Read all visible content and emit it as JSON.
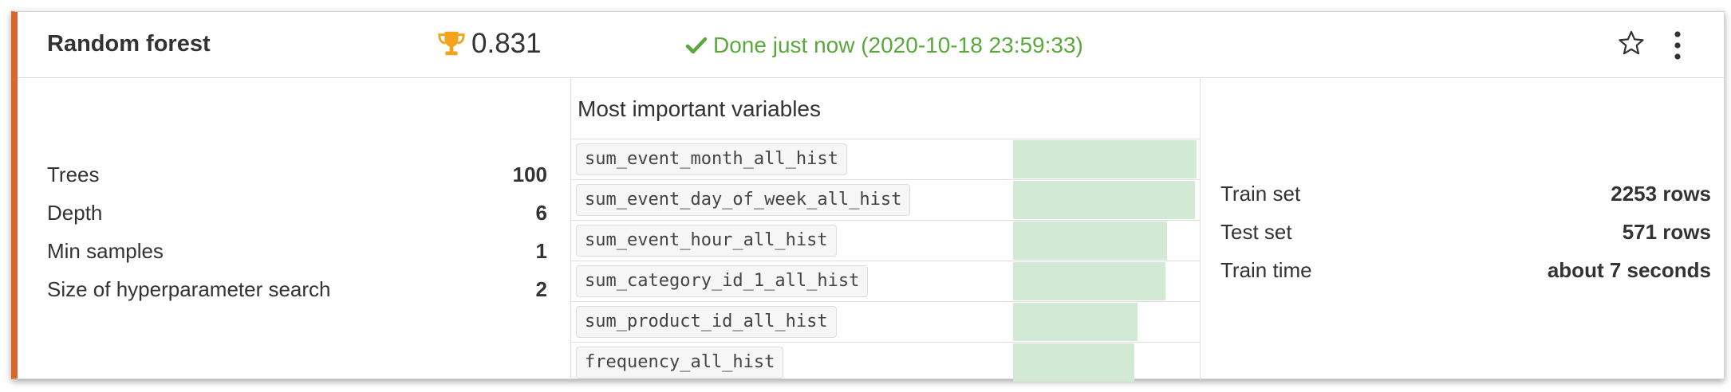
{
  "model": {
    "title": "Random forest",
    "score": "0.831",
    "status": "Done just now (2020-10-18 23:59:33)"
  },
  "colors": {
    "accent": "#d9662b",
    "success": "#5aa83c",
    "bar": "#d2e9d3",
    "trophy": "#f2a31b"
  },
  "icons": {
    "score": "trophy-icon",
    "status": "check-icon",
    "star": "star-icon",
    "menu": "more-vertical-icon"
  },
  "params": [
    {
      "label": "Trees",
      "value": "100"
    },
    {
      "label": "Depth",
      "value": "6"
    },
    {
      "label": "Min samples",
      "value": "1"
    },
    {
      "label": "Size of hyperparameter search",
      "value": "2"
    }
  ],
  "variables": {
    "title": "Most important variables",
    "items": [
      {
        "name": "sum_event_month_all_hist",
        "importance": 1.0
      },
      {
        "name": "sum_event_day_of_week_all_hist",
        "importance": 0.99
      },
      {
        "name": "sum_event_hour_all_hist",
        "importance": 0.84
      },
      {
        "name": "sum_category_id_1_all_hist",
        "importance": 0.83
      },
      {
        "name": "sum_product_id_all_hist",
        "importance": 0.68
      },
      {
        "name": "frequency_all_hist",
        "importance": 0.66
      }
    ]
  },
  "train": [
    {
      "label": "Train set",
      "value": "2253 rows"
    },
    {
      "label": "Test set",
      "value": "571 rows"
    },
    {
      "label": "Train time",
      "value": "about 7 seconds"
    }
  ]
}
